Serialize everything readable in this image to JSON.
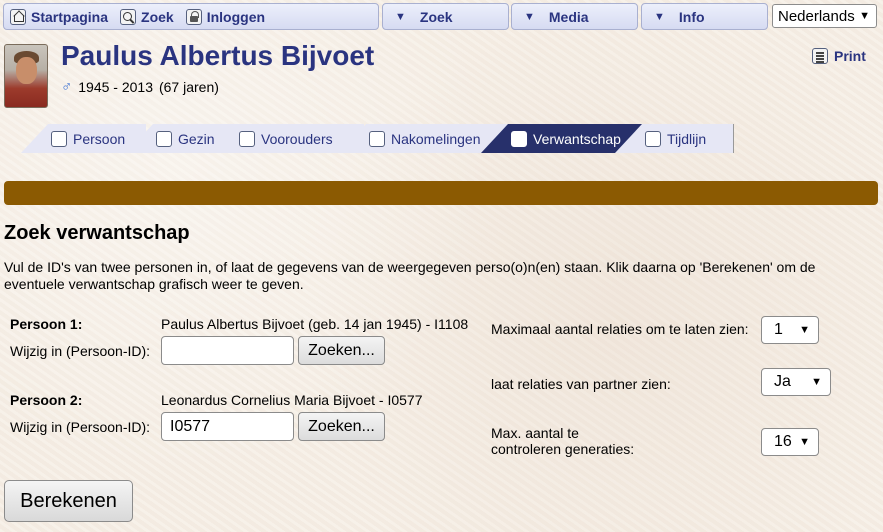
{
  "nav": {
    "home": "Startpagina",
    "search": "Zoek",
    "login": "Inloggen",
    "dropdowns": [
      "Zoek",
      "Media",
      "Info"
    ],
    "language": "Nederlands"
  },
  "person": {
    "name": "Paulus Albertus Bijvoet",
    "sex_symbol": "♂",
    "years": "1945 - 2013",
    "age": "(67 jaren)"
  },
  "print_label": "Print",
  "tabs": [
    {
      "label": "Persoon",
      "icon": "person-icon"
    },
    {
      "label": "Gezin",
      "icon": "family-icon"
    },
    {
      "label": "Voorouders",
      "icon": "ancestors-icon"
    },
    {
      "label": "Nakomelingen",
      "icon": "descendants-icon"
    },
    {
      "label": "Verwantschap",
      "icon": "relationship-icon",
      "active": true
    },
    {
      "label": "Tijdlijn",
      "icon": "timeline-icon"
    }
  ],
  "page": {
    "title": "Zoek verwantschap",
    "description": "Vul de ID's van twee personen in, of laat de gegevens van de weergegeven perso(o)n(en) staan. Klik daarna op 'Berekenen' om de eventuele verwantschap grafisch weer te geven."
  },
  "form": {
    "person1_label": "Persoon 1:",
    "person1_value": "Paulus Albertus Bijvoet (geb. 14 jan 1945) - I1108",
    "person2_label": "Persoon 2:",
    "person2_value": "Leonardus Cornelius Maria Bijvoet - I0577",
    "change_label": "Wijzig in (Persoon-ID):",
    "person1_input": "",
    "person2_input": "I0577",
    "search_button": "Zoeken...",
    "max_relations_label": "Maximaal aantal relaties om te laten zien:",
    "max_relations_value": "1",
    "partner_label": "laat relaties van partner zien:",
    "partner_value": "Ja",
    "generations_label_1": "Max. aantal te",
    "generations_label_2": "controleren generaties:",
    "generations_value": "16",
    "calculate_button": "Berekenen"
  }
}
